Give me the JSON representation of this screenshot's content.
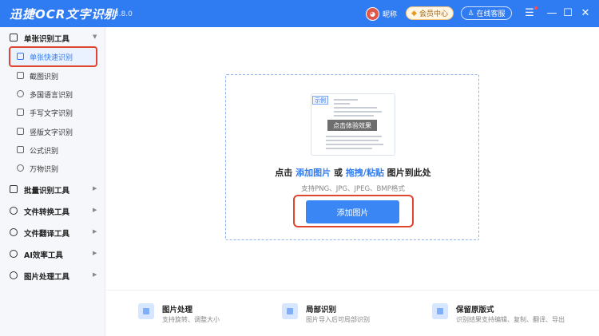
{
  "app": {
    "title": "迅捷OCR文字识别",
    "version": "v8.8.8.0"
  },
  "header": {
    "avatar_text": "◕",
    "nickname": "昵称",
    "vip_label": "会员中心",
    "service_label": "在线客服"
  },
  "sidebar": {
    "groups": [
      {
        "label": "单张识别工具",
        "expanded": true
      },
      {
        "label": "批量识别工具"
      },
      {
        "label": "文件转换工具"
      },
      {
        "label": "文件翻译工具"
      },
      {
        "label": "AI效率工具"
      },
      {
        "label": "图片处理工具"
      }
    ],
    "items": [
      {
        "label": "单张快速识别",
        "active": true
      },
      {
        "label": "截图识别"
      },
      {
        "label": "多国语言识别"
      },
      {
        "label": "手写文字识别"
      },
      {
        "label": "竖版文字识别"
      },
      {
        "label": "公式识别"
      },
      {
        "label": "万物识别"
      }
    ]
  },
  "drop": {
    "sample_tag": "示例",
    "sample_button": "点击体验效果",
    "title_prefix": "点击 ",
    "title_link1": "添加图片",
    "title_mid": " 或 ",
    "title_link2": "拖拽/粘贴",
    "title_suffix": " 图片到此处",
    "formats": "支持PNG、JPG、JPEG、BMP格式",
    "add_button": "添加图片"
  },
  "features": [
    {
      "title": "图片处理",
      "desc": "支持旋转、调整大小"
    },
    {
      "title": "局部识别",
      "desc": "图片导入后可局部识别"
    },
    {
      "title": "保留原版式",
      "desc": "识别结果支持编辑、复制、翻译、导出"
    }
  ],
  "colors": {
    "accent": "#2f7bf2",
    "highlight": "#e0452e"
  }
}
